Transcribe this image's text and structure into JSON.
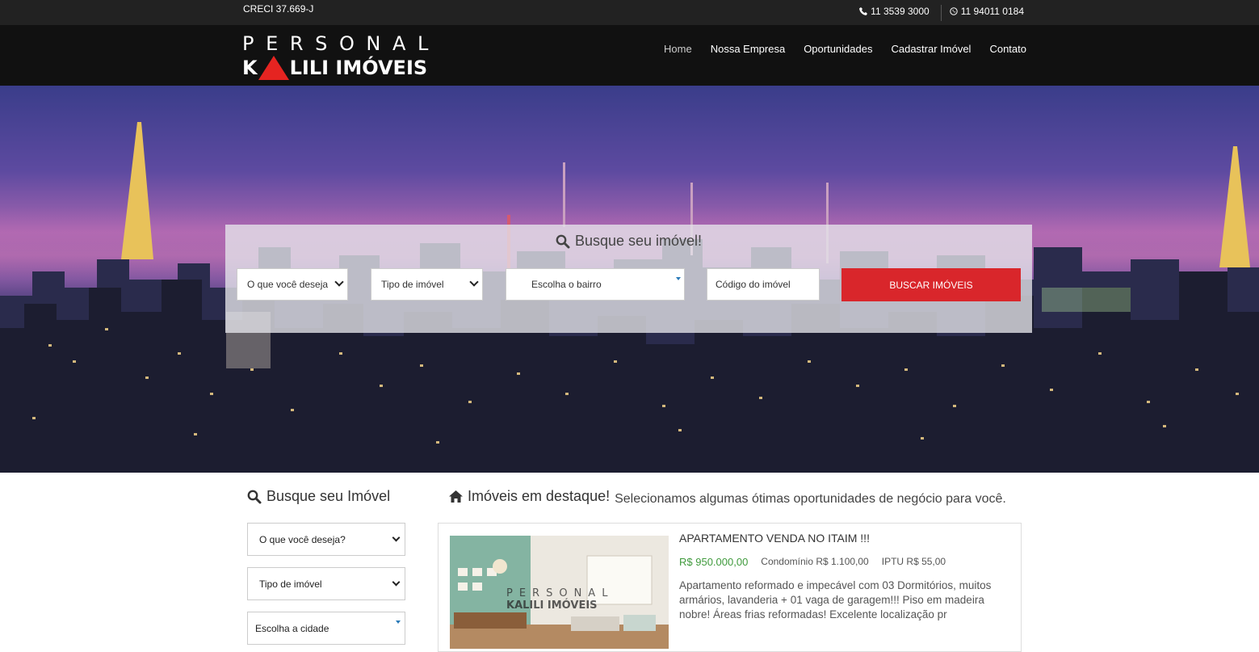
{
  "topbar": {
    "creci": "CRECI 37.669-J",
    "phone_label": "11 3539 3000",
    "whatsapp_label": "11 94011 0184"
  },
  "logo": {
    "line1": "PERSONAL",
    "line2_a": "K",
    "line2_b": "LILI IMÓVEIS"
  },
  "nav": {
    "items": [
      {
        "label": "Home"
      },
      {
        "label": "Nossa Empresa"
      },
      {
        "label": "Oportunidades"
      },
      {
        "label": "Cadastrar Imóvel"
      },
      {
        "label": "Contato"
      }
    ]
  },
  "hero_search": {
    "title": "Busque seu imóvel!",
    "what_select": "O que você deseja",
    "type_select": "Tipo de imóvel",
    "neighborhood_select": "Escolha o bairro",
    "code_placeholder": "Código do imóvel",
    "search_button": "BUSCAR IMÓVEIS"
  },
  "sidebar": {
    "title": "Busque seu Imóvel",
    "what_select": "O que você deseja?",
    "type_select": "Tipo de imóvel",
    "city_select": "Escolha a cidade"
  },
  "featured": {
    "title": "Imóveis em destaque!",
    "subtitle": "Selecionamos algumas ótimas oportunidades de negócio para você.",
    "listing": {
      "title": "APARTAMENTO VENDA NO ITAIM !!!",
      "price": "R$ 950.000,00",
      "condo": "Condomínio R$ 1.100,00",
      "iptu": "IPTU R$ 55,00",
      "description": "Apartamento reformado e impecável com 03 Dormitórios, muitos armários, lavanderia + 01 vaga de garagem!!! Piso em madeira nobre! Áreas frias reformadas! Excelente localização pr",
      "watermark_1": "PERSONAL",
      "watermark_2": "KALILI IMÓVEIS"
    }
  },
  "colors": {
    "accent_red": "#d9262b",
    "price_green": "#3f9a3c",
    "topbar_bg": "#222222",
    "navbar_bg": "#111111"
  }
}
